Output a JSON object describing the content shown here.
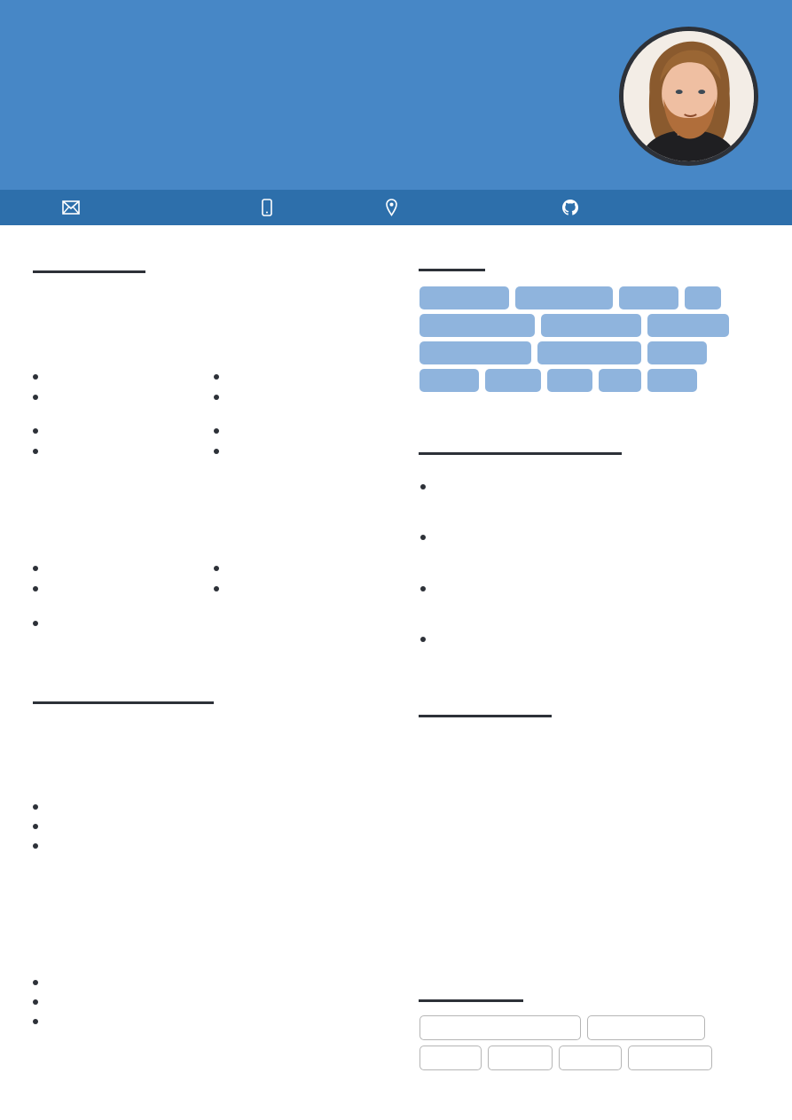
{
  "header": {
    "background": "#4787c6",
    "avatar": {
      "alt": "profile-photo"
    }
  },
  "contact_bar": {
    "background": "#2d6fab",
    "icons": [
      "mail-icon",
      "phone-icon",
      "location-icon",
      "github-icon"
    ]
  },
  "colors": {
    "heading_rule": "#2d3138",
    "skill_tag": "#8fb4dd",
    "outline_tag_border": "#b5b5b5"
  },
  "left_column": {
    "sections": [
      {
        "id": "section-1",
        "bullet_count": 13
      },
      {
        "id": "section-2",
        "bullet_count": 6
      }
    ]
  },
  "right_column": {
    "sections": [
      {
        "id": "skills",
        "tag_count": 16
      },
      {
        "id": "section-list",
        "bullet_count": 4
      },
      {
        "id": "section-text"
      },
      {
        "id": "languages",
        "tag_count": 6
      }
    ]
  }
}
